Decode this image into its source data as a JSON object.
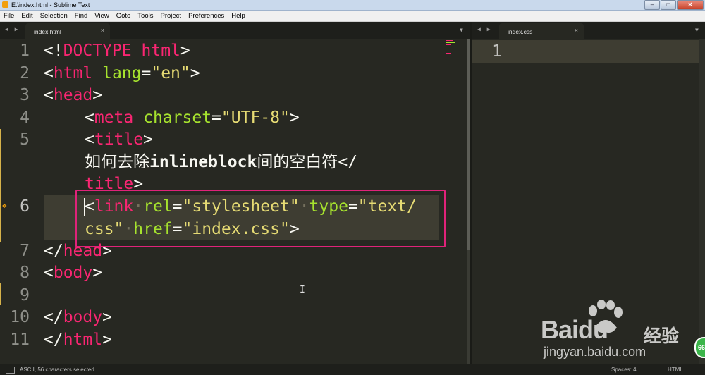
{
  "window": {
    "title": "E:\\index.html - Sublime Text",
    "controls": {
      "minimize": "–",
      "maximize": "□",
      "close": "✕"
    }
  },
  "menu": [
    "File",
    "Edit",
    "Selection",
    "Find",
    "View",
    "Goto",
    "Tools",
    "Project",
    "Preferences",
    "Help"
  ],
  "left_pane": {
    "nav_arrows": "◀ ▶",
    "tab_label": "index.html",
    "tab_close": "×",
    "dropdown": "▼",
    "line_numbers": [
      "1",
      "2",
      "3",
      "4",
      "5",
      "6",
      "7",
      "8",
      "9",
      "10",
      "11"
    ],
    "code": {
      "l1": {
        "a": "<!",
        "b": "DOCTYPE",
        "c": " ",
        "d": "html",
        "e": ">"
      },
      "l2": {
        "a": "<",
        "b": "html",
        "c": " ",
        "d": "lang",
        "e": "=",
        "f": "\"en\"",
        "g": ">"
      },
      "l3": {
        "a": "<",
        "b": "head",
        "c": ">"
      },
      "l4": {
        "a": "<",
        "b": "meta",
        "c": " ",
        "d": "charset",
        "e": "=",
        "f": "\"UTF-8\"",
        "g": ">"
      },
      "l5a": {
        "a": "<",
        "b": "title",
        "c": ">"
      },
      "l5b": {
        "a": "如何去除",
        "b": "inlineblock",
        "c": "间的空白符",
        "d": "</"
      },
      "l5c": {
        "a": "title",
        "b": ">"
      },
      "l6a": {
        "a": "<",
        "b": "link",
        "c": "·",
        "d": "rel",
        "e": "=",
        "f": "\"stylesheet\"",
        "g": "·",
        "h": "type",
        "i": "=",
        "j": "\"text/"
      },
      "l6b": {
        "a": "css\"",
        "b": "·",
        "c": "href",
        "d": "=",
        "e": "\"index.css\"",
        "f": ">"
      },
      "l7": {
        "a": "</",
        "b": "head",
        "c": ">"
      },
      "l8": {
        "a": "<",
        "b": "body",
        "c": ">"
      },
      "l10": {
        "a": "</",
        "b": "body",
        "c": ">"
      },
      "l11": {
        "a": "</",
        "b": "html",
        "c": ">"
      }
    }
  },
  "right_pane": {
    "nav_arrows": "◀ ▶",
    "tab_label": "index.css",
    "tab_close": "×",
    "dropdown": "▼",
    "line_numbers": [
      "1"
    ]
  },
  "status": {
    "text": "ASCII, 56 characters selected",
    "spaces": "Spaces: 4",
    "syntax": "HTML"
  },
  "watermark": {
    "brand_a": "Bai",
    "brand_b": "du",
    "cn": "经验",
    "url": "jingyan.baidu.com",
    "badge": "66"
  },
  "colors": {
    "background": "#272822",
    "tag": "#f92672",
    "attribute": "#a6e22e",
    "string": "#e6db74",
    "selection_box": "#e0237a"
  }
}
